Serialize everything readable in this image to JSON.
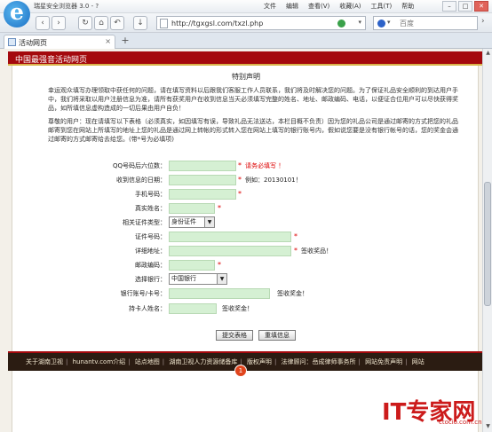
{
  "window": {
    "title": "瑞星安全浏览器 3.0 - ?",
    "menus": [
      "文件",
      "编辑",
      "查看(V)",
      "收藏(A)",
      "工具(T)",
      "帮助"
    ]
  },
  "nav": {
    "url": "http://tgxgsl.com/txzl.php",
    "search_placeholder": "百度"
  },
  "tab": {
    "label": "活动网页"
  },
  "site": {
    "header": "中国最强音活动网页"
  },
  "content": {
    "section_title": "特别声明",
    "notice1": "幸运观众填写办理领取中获任何的问题，请在填写资料以后跟我们客服工作人员联系，我们将及时解决您的问题。为了保证礼品安全顺利的到达用户手中，我们将采取以用户注册信息为准，请所有获奖用户在收到信息当天必须填写完整的姓名、地址、邮政编码、电话，以便证合位用户可以尽快获得奖品，如所填信息虚构造成的一切后果由用户自负！",
    "notice2": "尊敬的用户：现在请填写以下表格（必须真实，如因填写有误，导致礼品无法送达，本栏目概不负责）因为您的礼品公司是通过邮寄的方式把您的礼品邮寄到您在网站上所填写的地址上您的礼品是通过网上转帐的形式转入您在网站上填写的银行账号内，假如说您要是没有银行帐号的话，您的奖金会通过邮寄的方式邮寄给去给您。(带*号为必填项)"
  },
  "form": {
    "qq_label": "QQ号码后六位数：",
    "qq_note": "请务必填写 ！",
    "date_label": "收到信息的日期：",
    "date_note": "例如：20130101！",
    "phone_label": "手机号码：",
    "name_label": "真实姓名：",
    "idtype_label": "相关证件类型：",
    "idtype_value": "身份证件",
    "idnum_label": "证件号码：",
    "address_label": "详细地址：",
    "address_note": "签收奖品！",
    "zip_label": "邮政编码：",
    "bank_label": "选择银行：",
    "bank_value": "中国银行",
    "account_label": "银行账号/卡号：",
    "account_note": "签收奖金！",
    "holder_label": "持卡人姓名：",
    "holder_note": "签收奖金！",
    "submit_label": "提交表格",
    "reset_label": "重填信息"
  },
  "footer": {
    "links": [
      "关于湖南卫视",
      "hunantv.com介绍",
      "站点地图",
      "湖南卫视人力资源储备库",
      "版权声明",
      "法律顾问：岳成律师事务所",
      "网站免责声明",
      "网站"
    ],
    "badge": "1"
  },
  "watermark": {
    "text": "IT专家网",
    "domain": "ctocio.com.cn"
  },
  "colors": {
    "header": "#a4090d",
    "field": "#d5f0d3",
    "required": "#dd0000",
    "footer": "#2b1c12"
  },
  "icons": [
    "browser-logo-icon",
    "back-icon",
    "forward-icon",
    "refresh-icon",
    "home-icon",
    "undo-icon",
    "page-icon",
    "go-icon",
    "baidu-icon",
    "tab-page-icon",
    "close-icon",
    "new-tab-icon",
    "scroll-up-icon",
    "scroll-down-icon"
  ]
}
